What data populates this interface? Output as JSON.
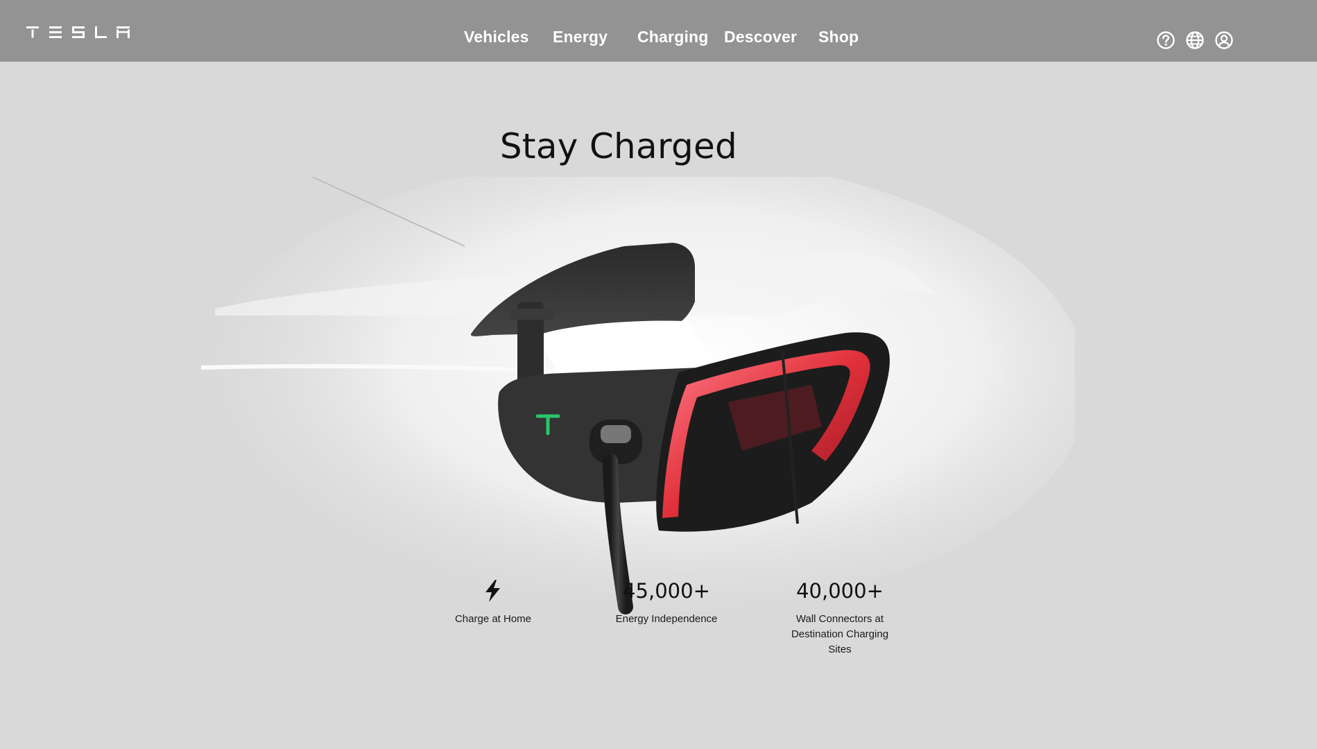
{
  "brand": "TESLA",
  "nav": {
    "items": [
      {
        "label": "Vehicles"
      },
      {
        "label": "Energy"
      },
      {
        "label": "Charging"
      },
      {
        "label": "Descover"
      },
      {
        "label": "Shop"
      }
    ]
  },
  "header_icons": [
    "help-icon",
    "globe-icon",
    "account-icon"
  ],
  "hero": {
    "title": "Stay Charged"
  },
  "stats": [
    {
      "icon": "lightning-icon",
      "value": "",
      "label": "Charge at Home"
    },
    {
      "value": "45,000+",
      "label": "Energy Independence"
    },
    {
      "value": "40,000+",
      "label": "Wall Connectors at Destination Charging Sites"
    }
  ],
  "colors": {
    "header_bg": "#939393",
    "page_bg": "#d9d9d9",
    "text": "#111111",
    "taillight": "#e0303a",
    "charge_led": "#29c46a"
  }
}
